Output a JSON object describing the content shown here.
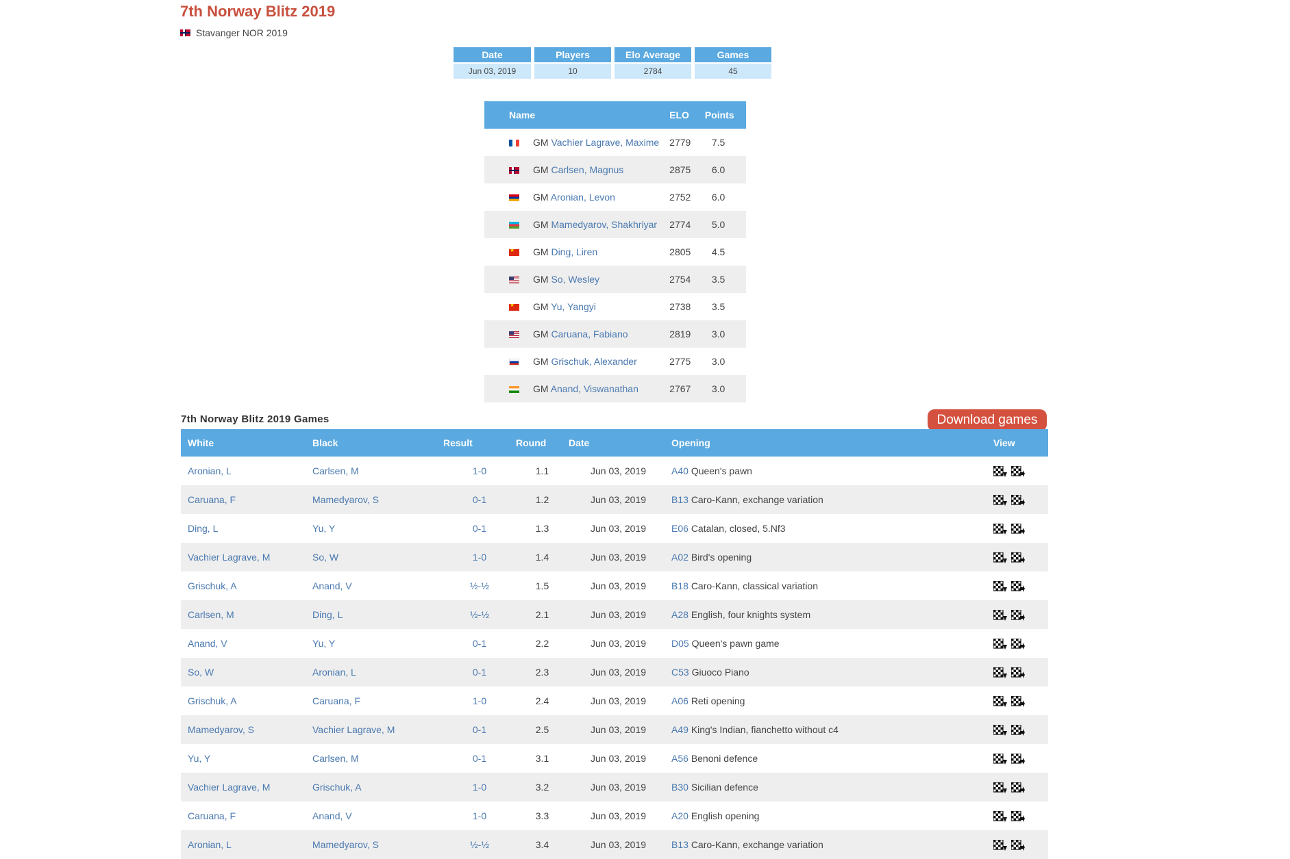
{
  "event": {
    "title": "7th Norway Blitz 2019",
    "location": "Stavanger NOR 2019"
  },
  "summary": [
    {
      "label": "Date",
      "value": "Jun 03, 2019"
    },
    {
      "label": "Players",
      "value": "10"
    },
    {
      "label": "Elo Average",
      "value": "2784"
    },
    {
      "label": "Games",
      "value": "45"
    }
  ],
  "players_table": {
    "headers": {
      "name": "Name",
      "elo": "ELO",
      "points": "Points"
    },
    "rows": [
      {
        "flag": "fra",
        "title": "GM",
        "name": "Vachier Lagrave, Maxime",
        "elo": "2779",
        "points": "7.5"
      },
      {
        "flag": "nor",
        "title": "GM",
        "name": "Carlsen, Magnus",
        "elo": "2875",
        "points": "6.0"
      },
      {
        "flag": "arm",
        "title": "GM",
        "name": "Aronian, Levon",
        "elo": "2752",
        "points": "6.0"
      },
      {
        "flag": "aze",
        "title": "GM",
        "name": "Mamedyarov, Shakhriyar",
        "elo": "2774",
        "points": "5.0"
      },
      {
        "flag": "chn",
        "title": "GM",
        "name": "Ding, Liren",
        "elo": "2805",
        "points": "4.5"
      },
      {
        "flag": "usa",
        "title": "GM",
        "name": "So, Wesley",
        "elo": "2754",
        "points": "3.5"
      },
      {
        "flag": "chn",
        "title": "GM",
        "name": "Yu, Yangyi",
        "elo": "2738",
        "points": "3.5"
      },
      {
        "flag": "usa",
        "title": "GM",
        "name": "Caruana, Fabiano",
        "elo": "2819",
        "points": "3.0"
      },
      {
        "flag": "rus",
        "title": "GM",
        "name": "Grischuk, Alexander",
        "elo": "2775",
        "points": "3.0"
      },
      {
        "flag": "ind",
        "title": "GM",
        "name": "Anand, Viswanathan",
        "elo": "2767",
        "points": "3.0"
      }
    ]
  },
  "games_section": {
    "title": "7th Norway Blitz 2019 Games",
    "download_label": "Download games",
    "headers": {
      "white": "White",
      "black": "Black",
      "result": "Result",
      "round": "Round",
      "date": "Date",
      "opening": "Opening",
      "view": "View"
    },
    "rows": [
      {
        "white": "Aronian, L",
        "black": "Carlsen, M",
        "result": "1-0",
        "round": "1.1",
        "date": "Jun 03, 2019",
        "eco": "A40",
        "opening": "Queen's pawn"
      },
      {
        "white": "Caruana, F",
        "black": "Mamedyarov, S",
        "result": "0-1",
        "round": "1.2",
        "date": "Jun 03, 2019",
        "eco": "B13",
        "opening": "Caro-Kann, exchange variation"
      },
      {
        "white": "Ding, L",
        "black": "Yu, Y",
        "result": "0-1",
        "round": "1.3",
        "date": "Jun 03, 2019",
        "eco": "E06",
        "opening": "Catalan, closed, 5.Nf3"
      },
      {
        "white": "Vachier Lagrave, M",
        "black": "So, W",
        "result": "1-0",
        "round": "1.4",
        "date": "Jun 03, 2019",
        "eco": "A02",
        "opening": "Bird's opening"
      },
      {
        "white": "Grischuk, A",
        "black": "Anand, V",
        "result": "½-½",
        "round": "1.5",
        "date": "Jun 03, 2019",
        "eco": "B18",
        "opening": "Caro-Kann, classical variation"
      },
      {
        "white": "Carlsen, M",
        "black": "Ding, L",
        "result": "½-½",
        "round": "2.1",
        "date": "Jun 03, 2019",
        "eco": "A28",
        "opening": "English, four knights system"
      },
      {
        "white": "Anand, V",
        "black": "Yu, Y",
        "result": "0-1",
        "round": "2.2",
        "date": "Jun 03, 2019",
        "eco": "D05",
        "opening": "Queen's pawn game"
      },
      {
        "white": "So, W",
        "black": "Aronian, L",
        "result": "0-1",
        "round": "2.3",
        "date": "Jun 03, 2019",
        "eco": "C53",
        "opening": "Giuoco Piano"
      },
      {
        "white": "Grischuk, A",
        "black": "Caruana, F",
        "result": "1-0",
        "round": "2.4",
        "date": "Jun 03, 2019",
        "eco": "A06",
        "opening": "Reti opening"
      },
      {
        "white": "Mamedyarov, S",
        "black": "Vachier Lagrave, M",
        "result": "0-1",
        "round": "2.5",
        "date": "Jun 03, 2019",
        "eco": "A49",
        "opening": "King's Indian, fianchetto without c4"
      },
      {
        "white": "Yu, Y",
        "black": "Carlsen, M",
        "result": "0-1",
        "round": "3.1",
        "date": "Jun 03, 2019",
        "eco": "A56",
        "opening": "Benoni defence"
      },
      {
        "white": "Vachier Lagrave, M",
        "black": "Grischuk, A",
        "result": "1-0",
        "round": "3.2",
        "date": "Jun 03, 2019",
        "eco": "B30",
        "opening": "Sicilian defence"
      },
      {
        "white": "Caruana, F",
        "black": "Anand, V",
        "result": "1-0",
        "round": "3.3",
        "date": "Jun 03, 2019",
        "eco": "A20",
        "opening": "English opening"
      },
      {
        "white": "Aronian, L",
        "black": "Mamedyarov, S",
        "result": "½-½",
        "round": "3.4",
        "date": "Jun 03, 2019",
        "eco": "B13",
        "opening": "Caro-Kann, exchange variation"
      }
    ]
  },
  "colors": {
    "title": "#c8503e",
    "header_bg": "#5aa9e0",
    "summary_value_bg": "#cde8fa",
    "link": "#4a79b0",
    "download_bg": "#d5513f"
  },
  "icons": {
    "location_flag": "norway-flag-icon",
    "view_download": "chessboard-download-icon",
    "view_open": "chessboard-open-icon"
  }
}
